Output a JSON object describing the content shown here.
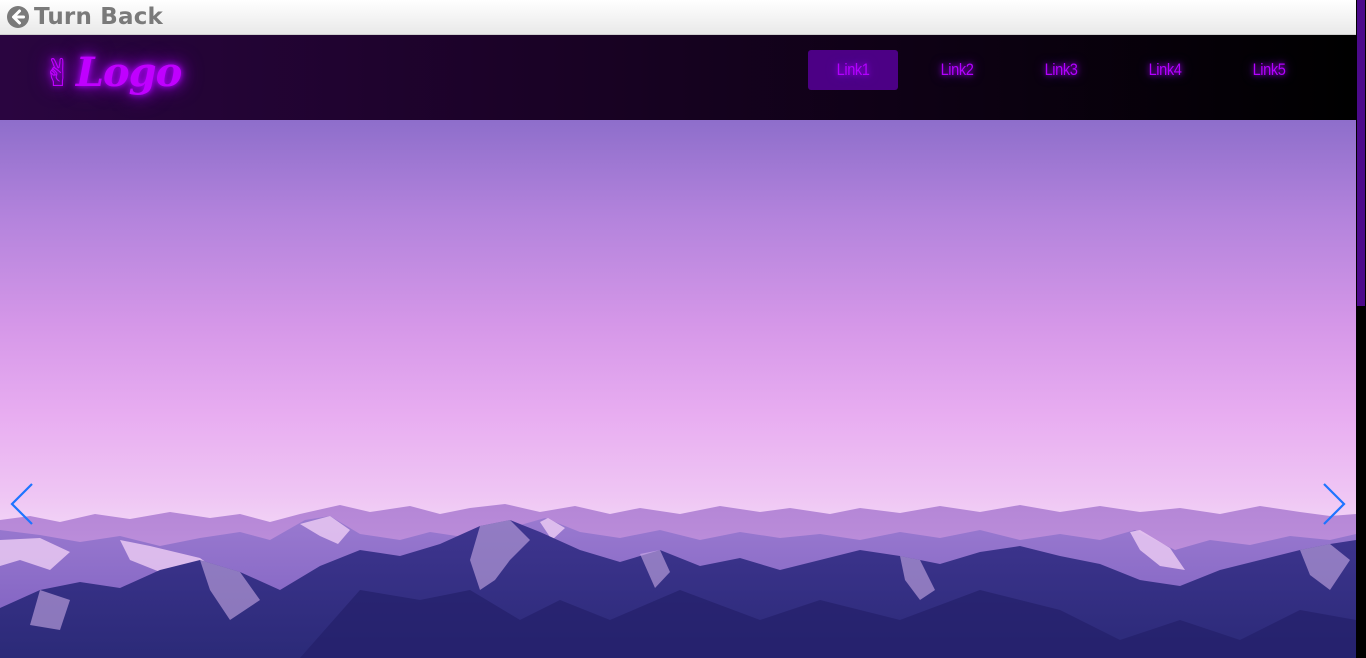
{
  "topbar": {
    "back_label": "Turn Back",
    "back_icon": "circle-arrow-left-icon"
  },
  "navbar": {
    "logo_icon": "peace-hand-icon",
    "logo_text": "Logo",
    "accent_color": "#c000ff",
    "links": [
      {
        "label": "Link1",
        "active": true
      },
      {
        "label": "Link2",
        "active": false
      },
      {
        "label": "Link3",
        "active": false
      },
      {
        "label": "Link4",
        "active": false
      },
      {
        "label": "Link5",
        "active": false
      }
    ]
  },
  "carousel": {
    "prev_icon": "chevron-left-icon",
    "next_icon": "chevron-right-icon",
    "arrow_color": "#1e74ff",
    "slide_image": "purple-mountain-range"
  },
  "colors": {
    "nav_active_bg": "#4c0085",
    "scrollbar_thumb": "#4b0a8a"
  }
}
